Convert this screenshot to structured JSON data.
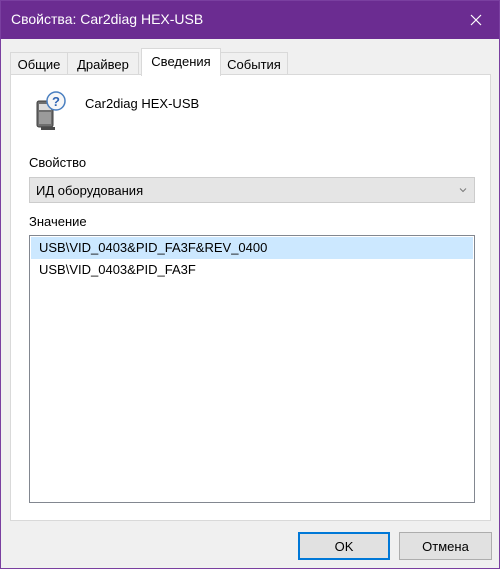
{
  "window": {
    "title": "Свойства: Car2diag HEX-USB"
  },
  "tabs": [
    {
      "label": "Общие"
    },
    {
      "label": "Драйвер"
    },
    {
      "label": "Сведения"
    },
    {
      "label": "События"
    }
  ],
  "device": {
    "name": "Car2diag HEX-USB",
    "icon": "unknown-device-icon"
  },
  "property": {
    "label": "Свойство",
    "selected": "ИД оборудования"
  },
  "value": {
    "label": "Значение",
    "items": [
      "USB\\VID_0403&PID_FA3F&REV_0400",
      "USB\\VID_0403&PID_FA3F"
    ]
  },
  "buttons": {
    "ok": "OK",
    "cancel": "Отмена"
  },
  "colors": {
    "titlebar": "#6b2c91",
    "selection": "#cce8ff",
    "focus_border": "#0078d7"
  }
}
